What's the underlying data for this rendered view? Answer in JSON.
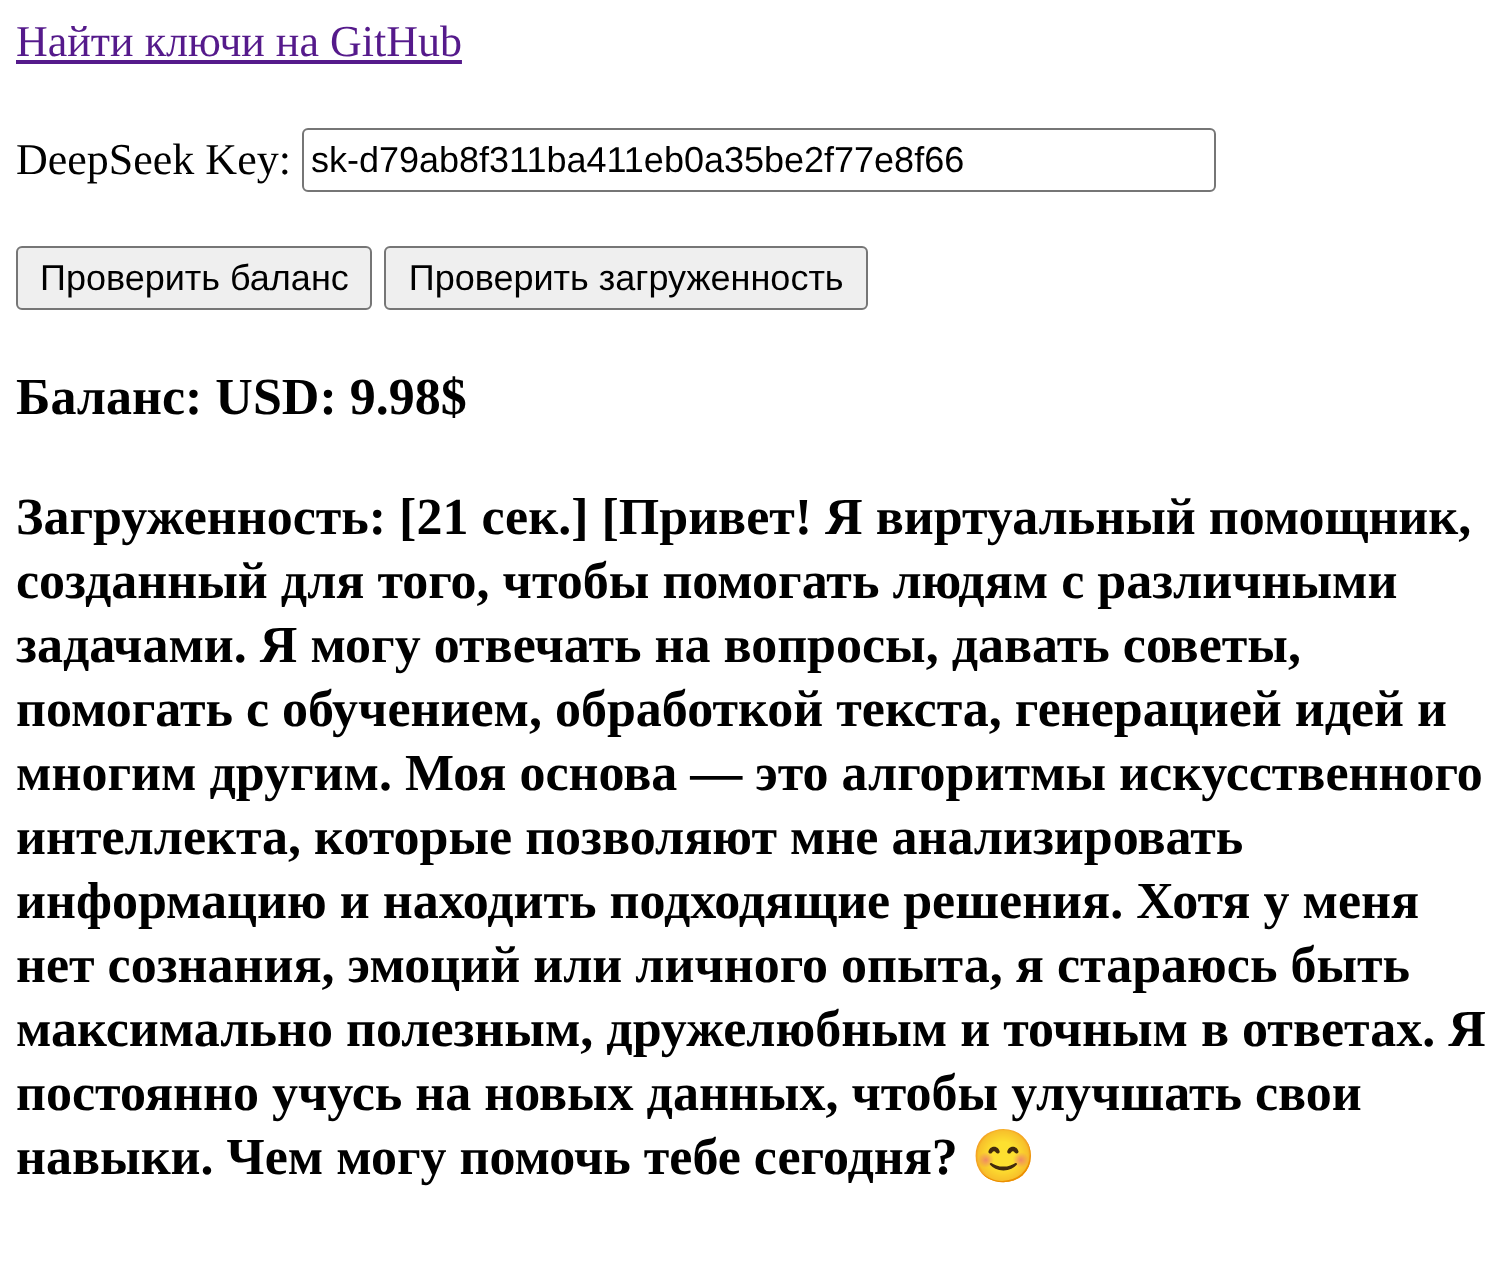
{
  "link": "Найти ключи на GitHub",
  "key_field": {
    "label": "DeepSeek Key:",
    "value": "sk-d79ab8f311ba411eb0a35be2f77e8f66"
  },
  "buttons": [
    "Проверить баланс",
    "Проверить загруженность"
  ],
  "balance": "Баланс: USD: 9.98$",
  "load": "Загруженность: [21 сек.] [Привет! Я виртуальный помощник, созданный для того, чтобы помогать людям с различными задачами. Я могу отвечать на вопросы, давать советы, помогать с обучением, обработкой текста, генерацией идей и многим другим. Моя основа — это алгоритмы искусственного интеллекта, которые позволяют мне анализировать информацию и находить подходящие решения. Хотя у меня нет сознания, эмоций или личного опыта, я стараюсь быть максимально полезным, дружелюбным и точным в ответах. Я постоянно учусь на новых данных, чтобы улучшать свои навыки. Чем могу помочь тебе сегодня? 😊"
}
